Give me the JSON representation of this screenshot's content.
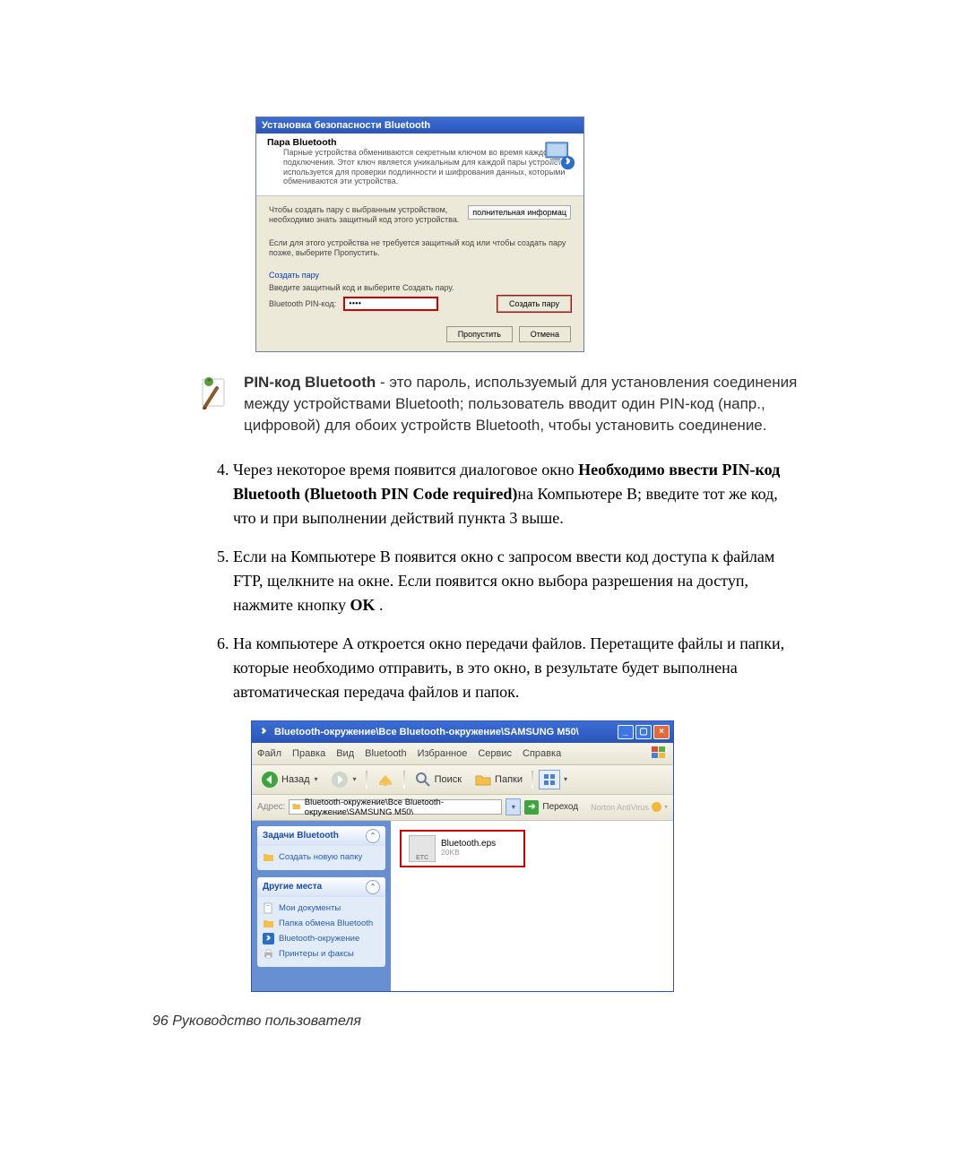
{
  "dialog1": {
    "title": "Установка безопасности Bluetooth",
    "section_heading": "Пара Bluetooth",
    "section_desc": "Парные устройства обмениваются секретным ключом во время каждого подключения. Этот ключ является уникальным для каждой пары устройств и используется для проверки подлинности и шифрования данных, которыми обмениваются эти устройства.",
    "pair_instruction": "Чтобы создать пару с выбранным устройством, необходимо знать защитный код этого устройства.",
    "more_info_btn": "полнительная информац",
    "skip_note": "Если для этого устройства не требуется защитный код или чтобы создать пару позже, выберите Пропустить.",
    "subsection_title": "Создать пару",
    "enter_prompt": "Введите защитный код и выберите Создать пару.",
    "pin_label": "Bluetooth PIN-код:",
    "pin_value": "••••",
    "pair_btn": "Создать пару",
    "skip_btn": "Пропустить",
    "cancel_btn": "Отмена"
  },
  "note": {
    "bold": "PIN-код Bluetooth",
    "text": " - это пароль, используемый для установления соединения между устройствами Bluetooth; пользователь вводит один PIN-код (напр., цифровой) для обоих устройств Bluetooth, чтобы установить соединение."
  },
  "steps": {
    "s4_a": "Через некоторое время появится диалоговое окно ",
    "s4_b1": "Необходимо ввести PIN-код Bluetooth (Bluetooth PIN Code required)",
    "s4_c": "на Компьютере B; введите тот же код, что и при выполнении действий пункта 3 выше.",
    "s5_a": "Если на Компьютере B появится окно с запросом ввести код доступа к файлам FTP, щелкните на окне. Если появится окно выбора разрешения на доступ, нажмите кнопку ",
    "s5_b": "OK",
    "s5_c": " .",
    "s6": "На компьютере A откроется окно передачи файлов. Перетащите файлы и папки, которые необходимо отправить, в это окно, в результате будет выполнена автоматическая передача файлов и папок."
  },
  "explorer": {
    "title": "Bluetooth-окружение\\Все Bluetooth-окружение\\SAMSUNG M50\\",
    "menu": [
      "Файл",
      "Правка",
      "Вид",
      "Bluetooth",
      "Избранное",
      "Сервис",
      "Справка"
    ],
    "back": "Назад",
    "search": "Поиск",
    "folders": "Папки",
    "addr_label": "Адрес:",
    "addr_value": "Bluetooth-окружение\\Все Bluetooth-окружение\\SAMSUNG M50\\",
    "go": "Переход",
    "norton": "Norton AntiVirus",
    "panel1_title": "Задачи Bluetooth",
    "panel1_item": "Создать новую папку",
    "panel2_title": "Другие места",
    "panel2_items": [
      "Мои документы",
      "Папка обмена Bluetooth",
      "Bluetooth-окружение",
      "Принтеры и факсы"
    ],
    "file_name": "Bluetooth.eps",
    "file_size": "20KB"
  },
  "page_footer": "96  Руководство пользователя"
}
